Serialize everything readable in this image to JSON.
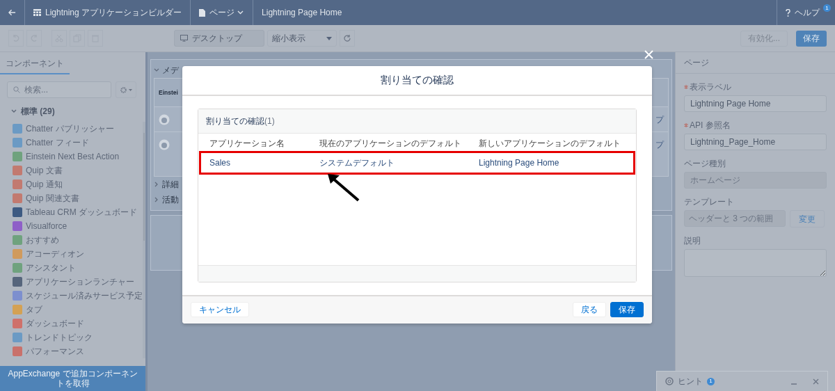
{
  "top_bar": {
    "items": [
      {
        "label": "Lightning アプリケーションビルダー",
        "kind": "app"
      },
      {
        "label": "ページ",
        "kind": "menu"
      },
      {
        "label": "Lightning Page Home",
        "kind": "text"
      }
    ],
    "help": {
      "label": "ヘルプ",
      "badge": "1"
    }
  },
  "toolbar": {
    "view": {
      "label": "デスクトップ"
    },
    "zoom": {
      "value": "縮小表示"
    },
    "activate_button": {
      "label": "有効化...",
      "disabled": true
    },
    "save_button": {
      "label": "保存"
    }
  },
  "left_panel": {
    "tab": {
      "label": "コンポーネント",
      "selected": true
    },
    "search": {
      "placeholder": "検索..."
    },
    "section": {
      "label": "標準 (29)",
      "expanded": true
    },
    "components": [
      {
        "label": "Chatter パブリッシャー",
        "color": "#6b9ac4"
      },
      {
        "label": "Chatter フィード",
        "color": "#6b9ac4"
      },
      {
        "label": "Einstein Next Best Action",
        "color": "#6fa27e"
      },
      {
        "label": "Quip 文書",
        "color": "#c27a70"
      },
      {
        "label": "Quip 通知",
        "color": "#c27a70"
      },
      {
        "label": "Quip 関連文書",
        "color": "#c27a70"
      },
      {
        "label": "Tableau CRM ダッシュボード",
        "color": "#3d5a82"
      },
      {
        "label": "Visualforce",
        "color": "#8e5fc8"
      },
      {
        "label": "おすすめ",
        "color": "#6fa27e"
      },
      {
        "label": "アコーディオン",
        "color": "#d09a5c"
      },
      {
        "label": "アシスタント",
        "color": "#6fa27e"
      },
      {
        "label": "アプリケーションランチャー",
        "color": "#56657c"
      },
      {
        "label": "スケジュール済みサービス予定",
        "color": "#7d8fce"
      },
      {
        "label": "タブ",
        "color": "#d4a153"
      },
      {
        "label": "ダッシュボード",
        "color": "#cf716b"
      },
      {
        "label": "トレンドトピック",
        "color": "#6b9ac4"
      },
      {
        "label": "パフォーマンス",
        "color": "#c9716b"
      }
    ],
    "footer_link": "AppExchange で追加コンポーネントを取得"
  },
  "canvas": {
    "sections": [
      {
        "label": "メデ",
        "expanded": true
      },
      {
        "label": "詳細",
        "expanded": false
      },
      {
        "label": "活動",
        "expanded": false
      }
    ],
    "card_title": "Einstei",
    "edge_texts": [
      "プ",
      "プ"
    ]
  },
  "right_panel": {
    "title": "ページ",
    "fields": [
      {
        "label": "表示ラベル",
        "required": true,
        "value": "Lightning Page Home",
        "disabled": false
      },
      {
        "label": "API 参照名",
        "required": true,
        "value": "Lightning_Page_Home",
        "disabled": false
      },
      {
        "label": "ページ種別",
        "required": false,
        "value": "ホームページ",
        "disabled": true
      },
      {
        "label": "テンプレート",
        "required": false,
        "value": "ヘッダーと 3 つの範囲",
        "disabled": true,
        "button": "変更"
      },
      {
        "label": "説明",
        "required": false,
        "kind": "textarea",
        "disabled": false
      }
    ]
  },
  "modal": {
    "title": "割り当ての確認",
    "card_title": "割り当ての確認",
    "count": "(1)",
    "columns": [
      "アプリケーション名",
      "現在のアプリケーションのデフォルト",
      "新しいアプリケーションのデフォルト"
    ],
    "rows": [
      {
        "cells": [
          "Sales",
          "システムデフォルト",
          "Lightning Page Home"
        ],
        "highlighted": true
      }
    ],
    "cancel_button": "キャンセル",
    "back_button": "戻る",
    "save_button": "保存"
  },
  "hint_bar": {
    "label": "ヒント",
    "badge": "1"
  }
}
